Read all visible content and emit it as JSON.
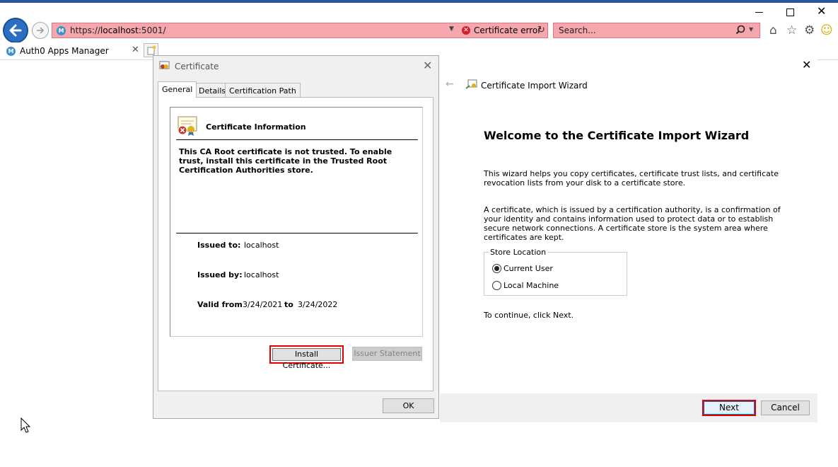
{
  "browser": {
    "url_scheme": "https://",
    "url_host": "localhost",
    "url_port": ":5001/",
    "cert_error": "Certificate error",
    "search_placeholder": "Search...",
    "tab_label": "Auth0 Apps Manager",
    "favicon_letter": "M",
    "colors": {
      "error_bar": "#f6a6ad",
      "back_button": "#2a6fc1"
    }
  },
  "cert_dialog": {
    "title": "Certificate",
    "tabs": [
      "General",
      "Details",
      "Certification Path"
    ],
    "info_title": "Certificate Information",
    "warning": "This CA Root certificate is not trusted. To enable trust, install this certificate in the Trusted Root Certification Authorities store.",
    "issued_to_label": "Issued to:",
    "issued_to": "localhost",
    "issued_by_label": "Issued by:",
    "issued_by": "localhost",
    "valid_from_label": "Valid from",
    "valid_from": "3/24/2021",
    "valid_to_label": "to",
    "valid_to": "3/24/2022",
    "install_button": "Install Certificate...",
    "issuer_statement_button": "Issuer Statement",
    "ok_button": "OK"
  },
  "wizard": {
    "title": "Certificate Import Wizard",
    "heading": "Welcome to the Certificate Import Wizard",
    "para1": "This wizard helps you copy certificates, certificate trust lists, and certificate revocation lists from your disk to a certificate store.",
    "para2": "A certificate, which is issued by a certification authority, is a confirmation of your identity and contains information used to protect data or to establish secure network connections. A certificate store is the system area where certificates are kept.",
    "store_location_label": "Store Location",
    "option_current_user": "Current User",
    "option_local_machine": "Local Machine",
    "selected_option": "Current User",
    "continue_text": "To continue, click Next.",
    "next_button": "Next",
    "cancel_button": "Cancel"
  }
}
